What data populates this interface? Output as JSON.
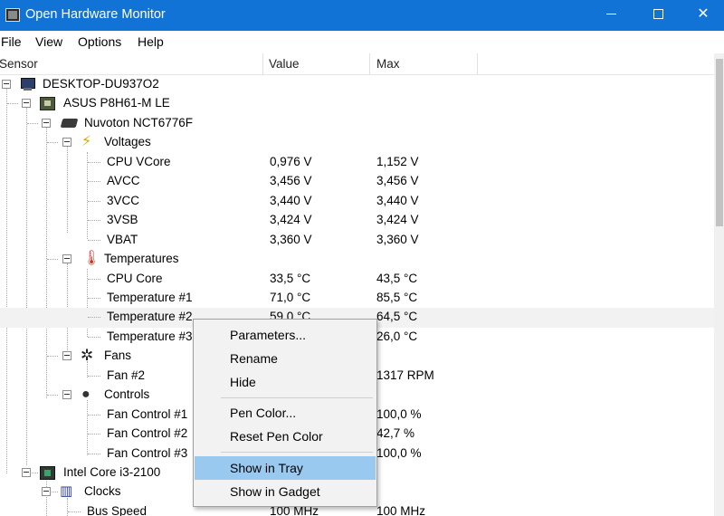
{
  "window": {
    "title": "Open Hardware Monitor"
  },
  "menu": [
    "File",
    "View",
    "Options",
    "Help"
  ],
  "columns": {
    "sensor": "Sensor",
    "value": "Value",
    "max": "Max"
  },
  "tree": {
    "computer": "DESKTOP-DU937O2",
    "board": "ASUS P8H61-M LE",
    "superio": "Nuvoton NCT6776F",
    "voltages": {
      "label": "Voltages",
      "rows": [
        {
          "name": "CPU VCore",
          "value": "0,976 V",
          "max": "1,152 V"
        },
        {
          "name": "AVCC",
          "value": "3,456 V",
          "max": "3,456 V"
        },
        {
          "name": "3VCC",
          "value": "3,440 V",
          "max": "3,440 V"
        },
        {
          "name": "3VSB",
          "value": "3,424 V",
          "max": "3,424 V"
        },
        {
          "name": "VBAT",
          "value": "3,360 V",
          "max": "3,360 V"
        }
      ]
    },
    "temperatures": {
      "label": "Temperatures",
      "rows": [
        {
          "name": "CPU Core",
          "value": "33,5 °C",
          "max": "43,5 °C"
        },
        {
          "name": "Temperature #1",
          "value": "71,0 °C",
          "max": "85,5 °C"
        },
        {
          "name": "Temperature #2",
          "value": "59,0 °C",
          "max": "64,5 °C"
        },
        {
          "name": "Temperature #3",
          "value": "",
          "max": "26,0 °C"
        }
      ]
    },
    "fans": {
      "label": "Fans",
      "rows": [
        {
          "name": "Fan #2",
          "value": "",
          "max": "1317 RPM"
        }
      ]
    },
    "controls": {
      "label": "Controls",
      "rows": [
        {
          "name": "Fan Control #1",
          "value": "",
          "max": "100,0 %"
        },
        {
          "name": "Fan Control #2",
          "value": "",
          "max": "42,7 %"
        },
        {
          "name": "Fan Control #3",
          "value": "",
          "max": "100,0 %"
        }
      ]
    },
    "cpu": "Intel Core i3-2100",
    "clocks": {
      "label": "Clocks",
      "rows": [
        {
          "name": "Bus Speed",
          "value": "100 MHz",
          "max": "100 MHz"
        }
      ]
    }
  },
  "context_menu": {
    "parameters": "Parameters...",
    "rename": "Rename",
    "hide": "Hide",
    "pen_color": "Pen Color...",
    "reset_pen_color": "Reset Pen Color",
    "show_in_tray": "Show in Tray",
    "show_in_gadget": "Show in Gadget"
  },
  "colors": {
    "titlebar": "#1273d6",
    "menu_highlight": "#99c9ef",
    "row_highlight": "#f2f2f2"
  }
}
